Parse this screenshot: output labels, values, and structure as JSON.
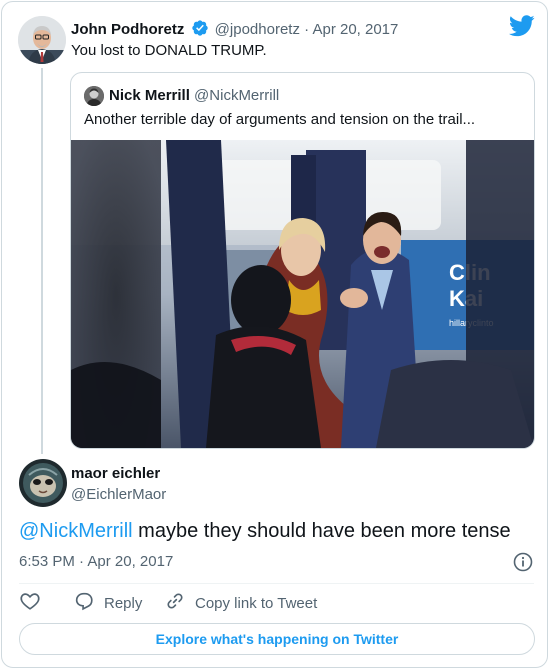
{
  "parent_tweet": {
    "author_name": "John Podhoretz",
    "handle": "@jpodhoretz",
    "separator": "·",
    "date": "Apr 20, 2017",
    "text": "You lost to DONALD TRUMP.",
    "icons": [
      "verified-badge-icon",
      "twitter-bird-icon"
    ]
  },
  "quoted_tweet": {
    "author_name": "Nick Merrill",
    "handle": "@NickMerrill",
    "text": "Another terrible day of arguments and tension on the trail...",
    "photo": {
      "signage": "Clinton Kaine hillaryclinton"
    }
  },
  "reply_tweet": {
    "author_name": "maor eichler",
    "handle": "@EichlerMaor",
    "mention": "@NickMerrill",
    "text": " maybe they should have been more tense",
    "time": "6:53 PM",
    "separator": "·",
    "date": "Apr 20, 2017"
  },
  "actions": {
    "like_icon": "heart-icon",
    "reply_label": "Reply",
    "copy_label": "Copy link to Tweet"
  },
  "explore_label": "Explore what's happening on Twitter",
  "colors": {
    "accent": "#1d9bf0",
    "muted": "#536471",
    "border": "#cfd9de",
    "text": "#0f1419"
  }
}
